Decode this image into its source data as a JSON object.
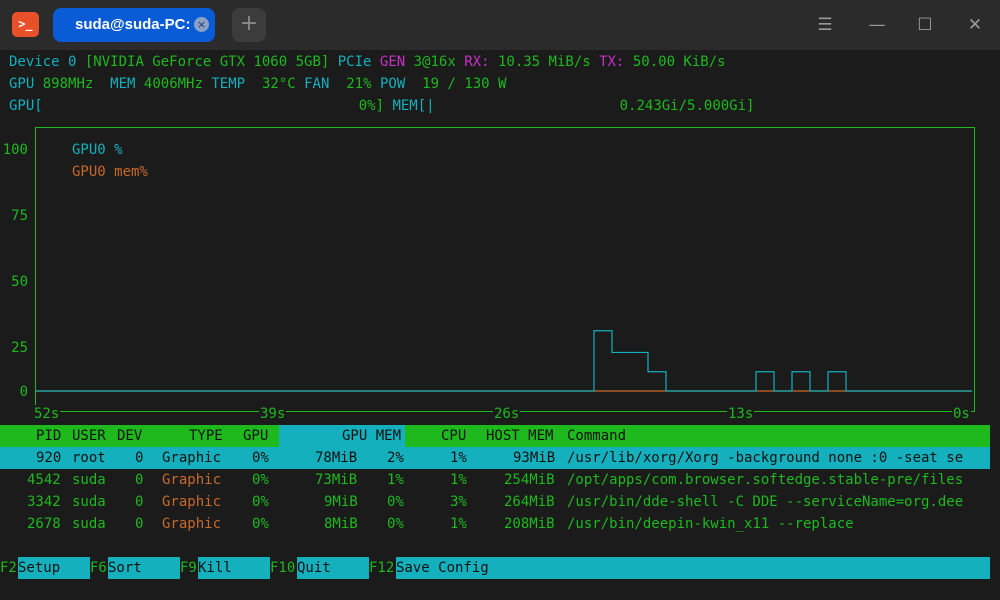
{
  "window": {
    "icon": "terminal-icon",
    "app_icon_glyph": ">_",
    "tab_title": "suda@suda-PC: ~",
    "tab_close_glyph": "×",
    "new_tab_glyph": "+",
    "menu_glyph": "☰",
    "minimize_glyph": "—",
    "maximize_glyph": "☐",
    "close_glyph": "✕"
  },
  "device": {
    "device_label": "Device 0",
    "name": "[NVIDIA GeForce GTX 1060 5GB]",
    "bus": "PCIe",
    "gen_label": "GEN",
    "gen_value": "3@16x",
    "rx_label": "RX:",
    "rx_value": "10.35 MiB/s",
    "tx_label": "TX:",
    "tx_value": "50.00 KiB/s",
    "gpu_clock_label": "GPU",
    "gpu_clock": "898MHz",
    "mem_clock_label": "MEM",
    "mem_clock": "4006MHz",
    "temp_label": "TEMP",
    "temp": "32°C",
    "fan_label": "FAN",
    "fan": "21%",
    "pow_label": "POW",
    "pow": "19 / 130 W",
    "gpu_bar_label": "GPU[",
    "gpu_bar_value": "0%]",
    "mem_bar_label": "MEM[|",
    "mem_bar_value": "0.243Gi/5.000Gi]"
  },
  "chart_data": {
    "type": "line",
    "x_tick_labels": [
      "52s",
      "39s",
      "26s",
      "13s",
      "0s"
    ],
    "y_tick_labels": [
      "100",
      "75",
      "50",
      "25",
      "0"
    ],
    "ylim": [
      0,
      100
    ],
    "xlim": [
      -52,
      0
    ],
    "x": [
      -52,
      -51,
      -50,
      -49,
      -48,
      -47,
      -46,
      -45,
      -44,
      -43,
      -42,
      -41,
      -40,
      -39,
      -38,
      -37,
      -36,
      -35,
      -34,
      -33,
      -32,
      -31,
      -30,
      -29,
      -28,
      -27,
      -26,
      -25,
      -24,
      -23,
      -22,
      -21,
      -20,
      -19,
      -18,
      -17,
      -16,
      -15,
      -14,
      -13,
      -12,
      -11,
      -10,
      -9,
      -8,
      -7,
      -6,
      -5,
      -4,
      -3,
      -2,
      -1,
      0
    ],
    "series": [
      {
        "name": "GPU0 %",
        "color": "#14b0bd",
        "values": [
          0,
          0,
          0,
          0,
          0,
          0,
          0,
          0,
          0,
          0,
          0,
          0,
          0,
          0,
          0,
          0,
          0,
          0,
          0,
          0,
          0,
          0,
          0,
          0,
          0,
          0,
          0,
          0,
          0,
          0,
          0,
          25,
          16,
          16,
          8,
          0,
          0,
          0,
          0,
          0,
          8,
          0,
          8,
          0,
          8,
          0,
          0,
          0,
          0,
          0,
          0,
          0,
          0
        ]
      },
      {
        "name": "GPU0 mem%",
        "color": "#c86a2a",
        "values": [
          0,
          0,
          0,
          0,
          0,
          0,
          0,
          0,
          0,
          0,
          0,
          0,
          0,
          0,
          0,
          0,
          0,
          0,
          0,
          0,
          0,
          0,
          0,
          0,
          0,
          0,
          0,
          0,
          0,
          0,
          0,
          0,
          0,
          0,
          0,
          0,
          0,
          0,
          0,
          0,
          0,
          0,
          0,
          0,
          0,
          0,
          0,
          0,
          0,
          0,
          0,
          0,
          0
        ]
      }
    ]
  },
  "table": {
    "headers": [
      "PID",
      "USER",
      "DEV",
      "TYPE",
      "GPU",
      "GPU MEM",
      "CPU",
      "HOST MEM",
      "Command"
    ],
    "rows": [
      [
        "920",
        "root",
        "0",
        "Graphic",
        "0%",
        "78MiB",
        "2%",
        "1%",
        "93MiB",
        "/usr/lib/xorg/Xorg -background none :0 -seat se"
      ],
      [
        "4542",
        "suda",
        "0",
        "Graphic",
        "0%",
        "73MiB",
        "1%",
        "1%",
        "254MiB",
        "/opt/apps/com.browser.softedge.stable-pre/files"
      ],
      [
        "3342",
        "suda",
        "0",
        "Graphic",
        "0%",
        "9MiB",
        "0%",
        "3%",
        "264MiB",
        "/usr/bin/dde-shell -C DDE --serviceName=org.dee"
      ],
      [
        "2678",
        "suda",
        "0",
        "Graphic",
        "0%",
        "8MiB",
        "0%",
        "1%",
        "208MiB",
        "/usr/bin/deepin-kwin_x11 --replace"
      ]
    ]
  },
  "footer": [
    {
      "key": "F2",
      "label": "Setup"
    },
    {
      "key": "F6",
      "label": "Sort"
    },
    {
      "key": "F9",
      "label": "Kill"
    },
    {
      "key": "F10",
      "label": "Quit"
    },
    {
      "key": "F12",
      "label": "Save Config"
    }
  ]
}
